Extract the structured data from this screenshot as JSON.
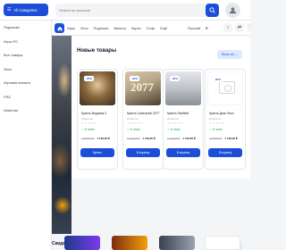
{
  "header": {
    "catalog_label": "All Categories",
    "search_placeholder": "Search for products"
  },
  "sidebar": {
    "items": [
      {
        "label": "Подписки"
      },
      {
        "label": "Игры PC"
      },
      {
        "label": "Все товары"
      },
      {
        "label": "Xbox"
      },
      {
        "label": "Игровая валюта"
      },
      {
        "label": "PS5"
      },
      {
        "label": "Nintendo"
      }
    ]
  },
  "nav": {
    "links": [
      "Игры",
      "Xbox",
      "Подписки",
      "Валюта",
      "Карты",
      "Софт",
      "Ещё"
    ],
    "lang": "Русский",
    "currency": "₽"
  },
  "section": {
    "title": "Новые товары",
    "more_label": "Show all →"
  },
  "products": [
    {
      "badge": "-20%",
      "name": "Купить Ведьмак 3",
      "publisher": "Издатель",
      "stars": "★★★★★",
      "stock": "In stock",
      "old_price": "1 499,00 ₽",
      "new_price": "1 199,00 ₽",
      "buy_label": "Купить"
    },
    {
      "badge": "-20%",
      "name": "Купить Cyberpunk 2077",
      "publisher": "Издатель",
      "stars": "★★★★★",
      "stock": "In stock",
      "old_price": "1 499,00 ₽",
      "new_price": "1 199,00 ₽",
      "buy_label": "В корзину",
      "image_text": "2077"
    },
    {
      "badge": "-20%",
      "name": "Купить Starfield",
      "publisher": "Издатель",
      "stars": "★★★★★",
      "stock": "In stock",
      "old_price": "1 499,00 ₽",
      "new_price": "1 199,00 ₽",
      "buy_label": "В корзину"
    },
    {
      "badge": "-20%",
      "name": "Купить Диск Xbox",
      "publisher": "Издатель",
      "stars": "★★★★★",
      "stock": "In stock",
      "old_price": "1 499,00 ₽",
      "new_price": "1 199,00 ₽",
      "buy_label": "В корзину"
    }
  ],
  "lower": {
    "title": "Скидки",
    "more_label": "Show all →"
  },
  "icons": {
    "catalog": "grid-icon",
    "search": "search-icon",
    "user": "user-icon",
    "home": "home-icon",
    "cart": "cart-icon"
  },
  "colors": {
    "accent": "#1d4ed8",
    "stock": "#16a34a"
  }
}
